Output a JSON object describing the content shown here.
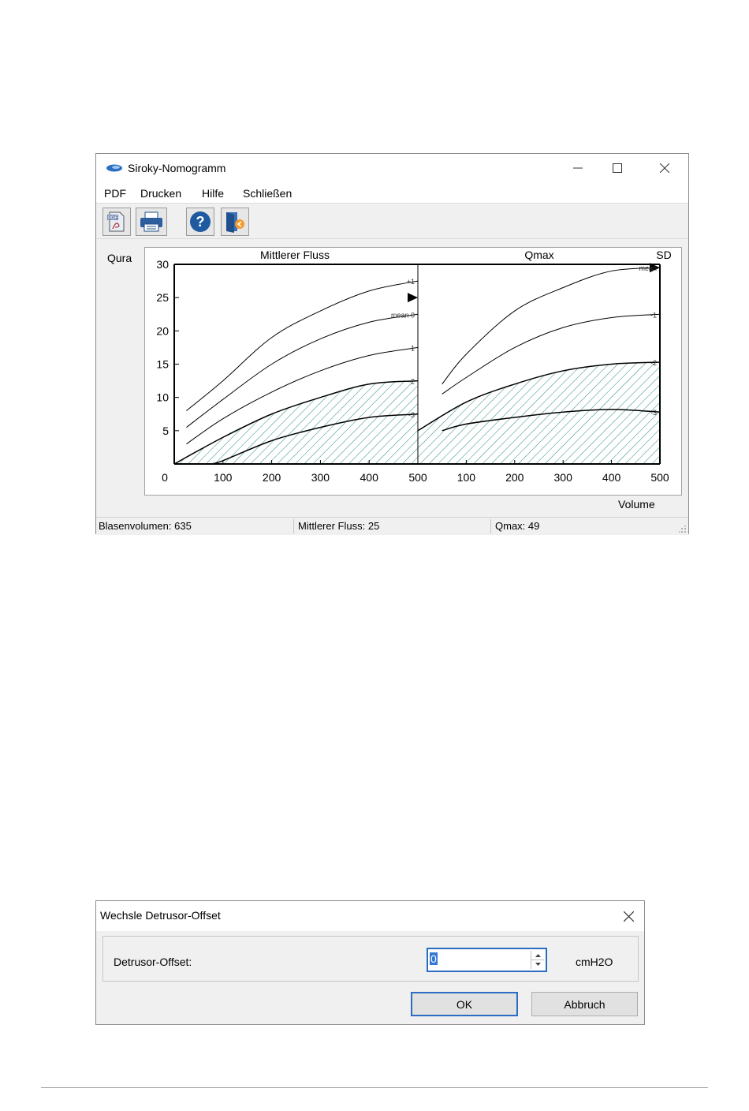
{
  "window1": {
    "title": "Siroky-Nomogramm",
    "menu": [
      {
        "label": "PDF"
      },
      {
        "label": "Drucken"
      },
      {
        "label": "Hilfe"
      },
      {
        "label": "Schließen"
      }
    ],
    "toolbar": {
      "icons": [
        "pdf-icon",
        "printer-icon",
        "help-icon",
        "exit-icon"
      ]
    },
    "status": {
      "blasenvolumen": "Blasenvolumen: 635",
      "mittlerer_fluss": "Mittlerer Fluss: 25",
      "qmax": "Qmax: 49"
    }
  },
  "chart_data": {
    "type": "line",
    "ylabel": "Qura",
    "xlabel": "Volume",
    "ylim": [
      0,
      30
    ],
    "yticks": [
      "30",
      "25",
      "20",
      "15",
      "10",
      "5",
      "0"
    ],
    "panels": [
      {
        "title": "Mittlerer Fluss",
        "xlim": [
          0,
          500
        ],
        "xticks": [
          "100",
          "200",
          "300",
          "400",
          "500"
        ],
        "series": [
          {
            "name": "+1",
            "x": [
              25,
              100,
              200,
              300,
              400,
              500
            ],
            "y": [
              8,
              12.5,
              19,
              23,
              26,
              27.5
            ]
          },
          {
            "name": "mean 0",
            "x": [
              25,
              100,
              200,
              300,
              400,
              500
            ],
            "y": [
              5.5,
              9.7,
              15,
              18.8,
              21.3,
              22.5
            ]
          },
          {
            "name": "-1",
            "x": [
              25,
              100,
              200,
              300,
              400,
              500
            ],
            "y": [
              3,
              6.8,
              10.8,
              14,
              16.3,
              17.5
            ]
          },
          {
            "name": "-2",
            "x": [
              0,
              100,
              200,
              300,
              400,
              500
            ],
            "y": [
              0,
              4,
              7.5,
              10,
              12,
              12.5
            ]
          },
          {
            "name": "-3",
            "x": [
              75,
              100,
              200,
              300,
              400,
              500
            ],
            "y": [
              0,
              0.5,
              3.5,
              5.5,
              7,
              7.5
            ]
          }
        ],
        "marker": {
          "label": "mittlerer fluss",
          "y": 25
        }
      },
      {
        "title": "Qmax",
        "xlim": [
          0,
          500
        ],
        "xticks": [
          "100",
          "200",
          "300",
          "400",
          "500"
        ],
        "right_label": "SD",
        "series": [
          {
            "name": "mean",
            "x": [
              50,
              100,
              200,
              300,
              400,
              500
            ],
            "y": [
              12,
              16.5,
              23,
              26.5,
              29,
              29.5
            ]
          },
          {
            "name": "-1",
            "x": [
              50,
              100,
              200,
              300,
              400,
              500
            ],
            "y": [
              10.5,
              13,
              17.5,
              20.5,
              22,
              22.5
            ]
          },
          {
            "name": "-2",
            "x": [
              0,
              100,
              200,
              300,
              400,
              500
            ],
            "y": [
              5,
              9.3,
              12,
              14,
              15,
              15.3
            ]
          },
          {
            "name": "-3",
            "x": [
              50,
              100,
              200,
              300,
              400,
              500
            ],
            "y": [
              5,
              6,
              7,
              7.8,
              8.2,
              7.8
            ]
          }
        ],
        "marker": {
          "label": "qmax",
          "y": 29.5
        }
      }
    ]
  },
  "window2": {
    "title": "Wechsle Detrusor-Offset",
    "field_label": "Detrusor-Offset:",
    "field_value": "0",
    "unit": "cmH2O",
    "ok_label": "OK",
    "cancel_label": "Abbruch"
  }
}
